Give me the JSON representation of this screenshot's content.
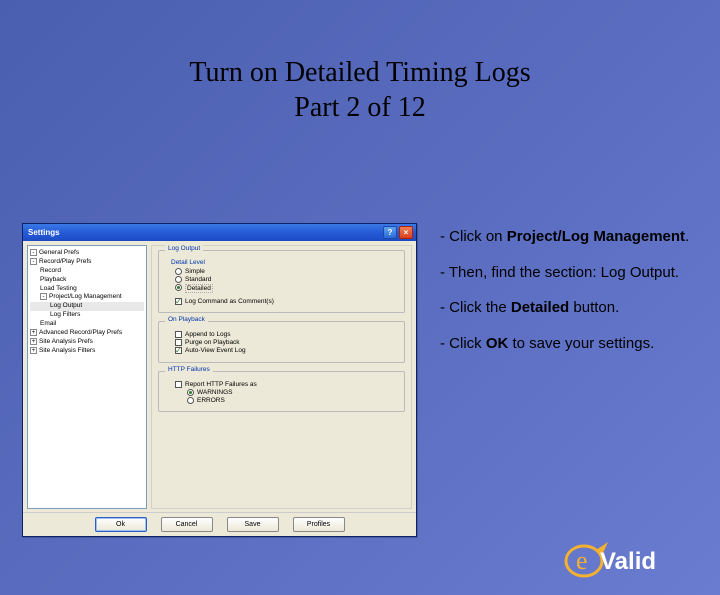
{
  "slide": {
    "title_line1": "Turn on Detailed Timing Logs",
    "title_line2": "Part 2 of 12"
  },
  "window": {
    "title": "Settings",
    "help_icon": "?",
    "close_icon": "×"
  },
  "tree": {
    "n0": "General Prefs",
    "n1": "Record/Play Prefs",
    "n1a": "Record",
    "n1b": "Playback",
    "n1c": "Load Testing",
    "n1d": "Project/Log Management",
    "n1d1": "Log Output",
    "n1d2": "Log Filters",
    "n1e": "Email",
    "n2": "Advanced Record/Play Prefs",
    "n3": "Site Analysis Prefs",
    "n4": "Site Analysis Filters"
  },
  "panel": {
    "group1_label": "Log Output",
    "detail_level": "Detail Level",
    "opt_simple": "Simple",
    "opt_standard": "Standard",
    "opt_detailed": "Detailed",
    "log_comment": "Log Command as Comment(s)",
    "group2_label": "On Playback",
    "append_logs": "Append to Logs",
    "purge_playback": "Purge on Playback",
    "auto_view": "Auto-View Event Log",
    "group3_label": "HTTP Failures",
    "report_http": "Report HTTP Failures as",
    "opt_warnings": "WARNINGS",
    "opt_errors": "ERRORS"
  },
  "buttons": {
    "ok": "Ok",
    "cancel": "Cancel",
    "save": "Save",
    "profiles": "Profiles"
  },
  "instructions": {
    "p1a": "- Click on ",
    "p1b": "Project/Log Management",
    "p1c": ".",
    "p2": "- Then, find the section: Log Output.",
    "p3a": "- Click the ",
    "p3b": "Detailed",
    "p3c": " button.",
    "p4a": "- Click ",
    "p4b": "OK",
    "p4c": " to save your settings."
  },
  "logo": {
    "text": "eValid"
  }
}
